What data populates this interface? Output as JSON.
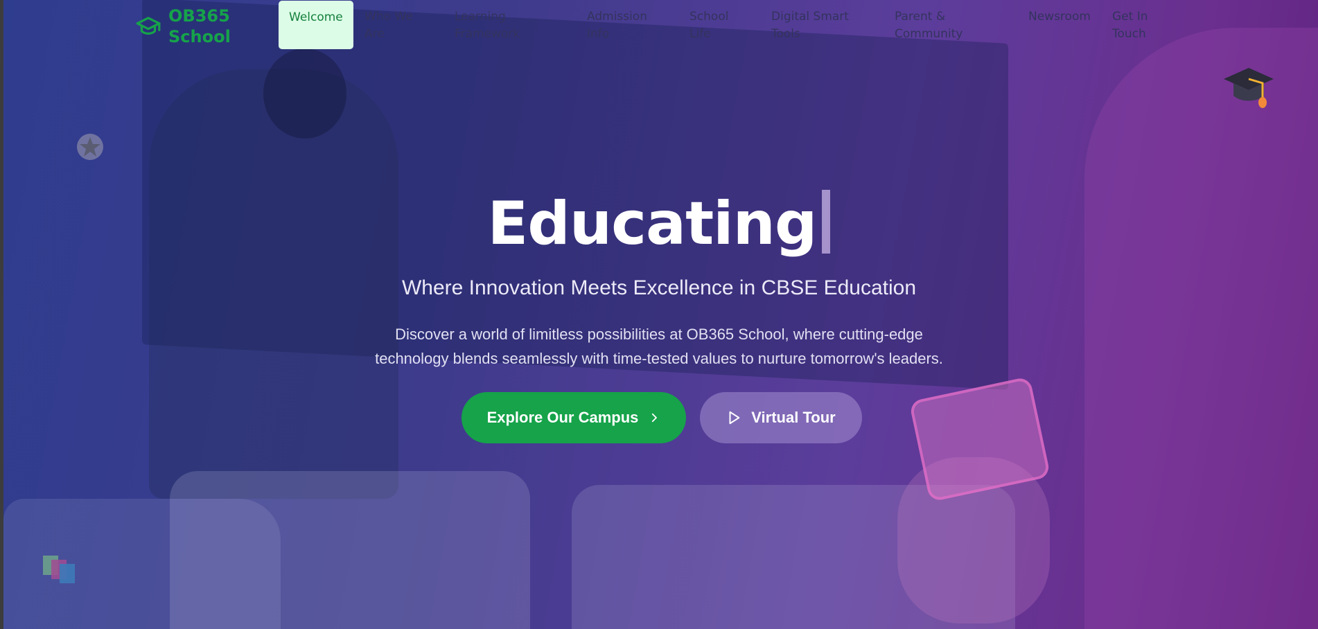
{
  "brand": {
    "name_line1": "OB365",
    "name_line2": "School",
    "icon": "graduation-cap-icon"
  },
  "nav": {
    "items": [
      {
        "label": "Welcome",
        "active": true
      },
      {
        "label": "Who We Are",
        "active": false
      },
      {
        "label": "Learning Framework",
        "active": false
      },
      {
        "label": "Admission Info",
        "active": false
      },
      {
        "label": "School Life",
        "active": false
      },
      {
        "label": "Digital Smart Tools",
        "active": false
      },
      {
        "label": "Parent & Community",
        "active": false
      },
      {
        "label": "Newsroom",
        "active": false
      },
      {
        "label": "Get In Touch",
        "active": false
      }
    ]
  },
  "hero": {
    "headline": "Educating",
    "subheadline": "Where Innovation Meets Excellence in CBSE Education",
    "description_line1": "Discover a world of limitless possibilities at OB365 School, where cutting-edge",
    "description_line2": "technology blends seamlessly with time-tested values to nurture tomorrow's leaders.",
    "primary_button": {
      "label": "Explore Our Campus",
      "icon": "chevron-right-icon"
    },
    "secondary_button": {
      "label": "Virtual Tour",
      "icon": "play-icon"
    }
  },
  "decorations": [
    "graduation-cap-emoji",
    "star-icon",
    "books-emoji"
  ],
  "colors": {
    "accent_green": "#16a34a",
    "active_nav_bg": "#dcfce7",
    "overlay_blue": "#2f3d8f",
    "overlay_purple": "#6a2f8f"
  }
}
